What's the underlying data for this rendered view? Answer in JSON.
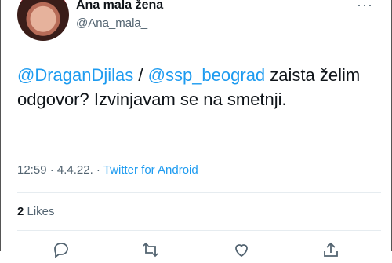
{
  "author": {
    "display_name": "Ana mala žena",
    "handle": "@Ana_mala_",
    "avatar_icon": "profile-photo"
  },
  "tweet": {
    "mention1": "@DraganDjilas",
    "separator": " / ",
    "mention2": "@ssp_beograd",
    "body": " zaista želim odgovor? Izvinjavam se na smetnji."
  },
  "meta": {
    "time": "12:59",
    "dot1": " · ",
    "date": "4.4.22.",
    "dot2": " · ",
    "source": "Twitter for Android"
  },
  "stats": {
    "likes_count": "2",
    "likes_label": " Likes"
  },
  "actions": [
    "reply-icon",
    "retweet-icon",
    "like-icon",
    "share-icon"
  ],
  "colors": {
    "link": "#1d9bf0",
    "text": "#0f1419",
    "secondary": "#536471"
  }
}
